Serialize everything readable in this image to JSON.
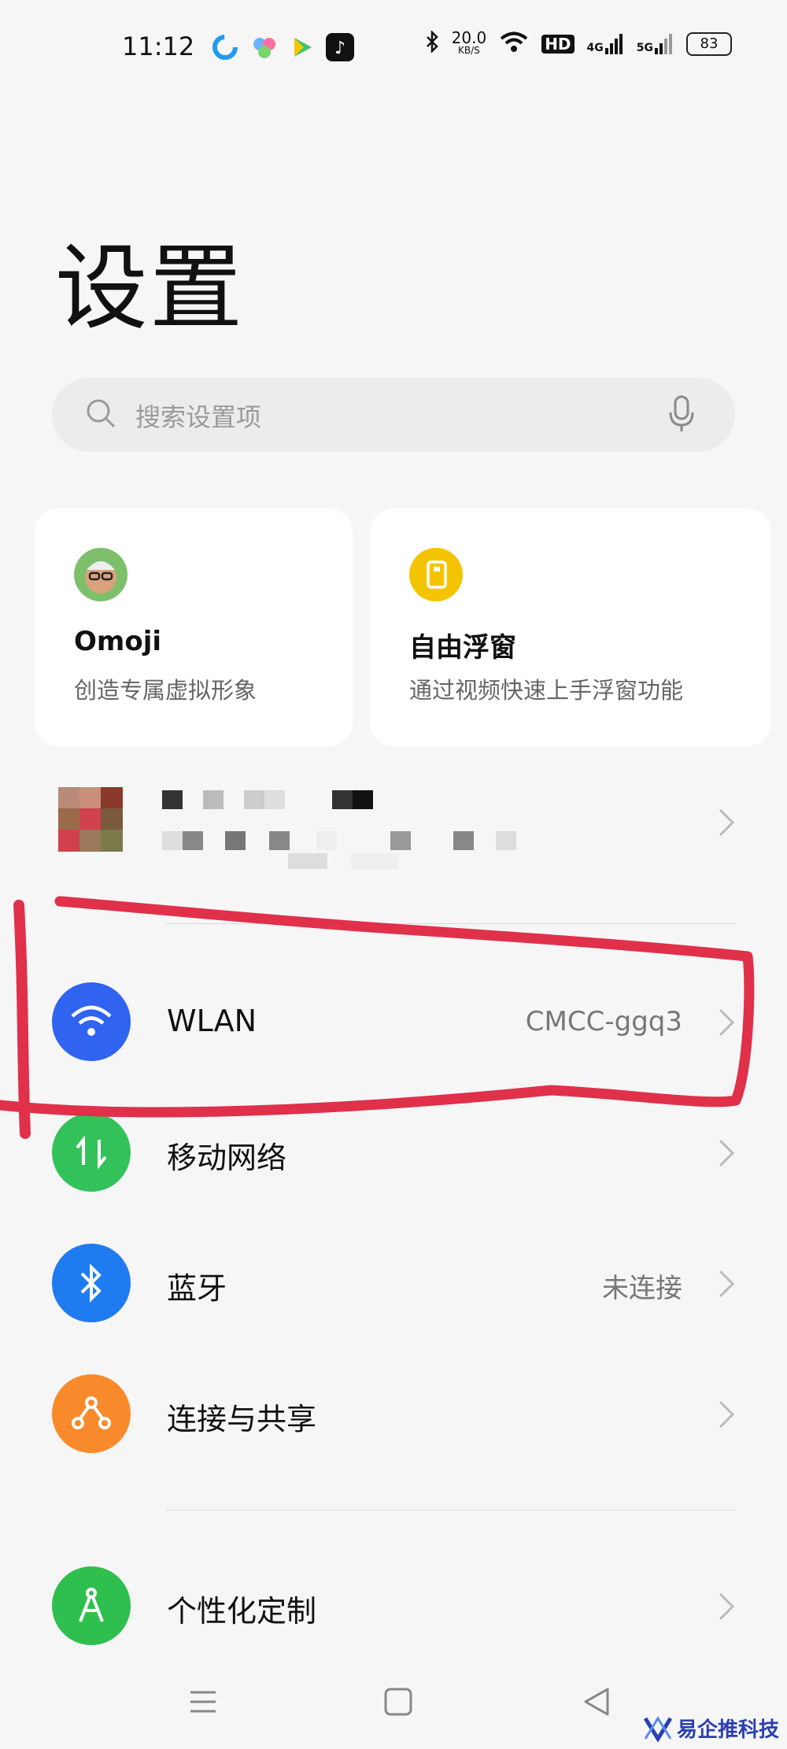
{
  "status_bar": {
    "time": "11:12",
    "speed_value": "20.0",
    "speed_unit": "KB/S",
    "hd": "HD",
    "net1": "4G",
    "net2": "5G",
    "battery": "83"
  },
  "page": {
    "title": "设置"
  },
  "search": {
    "placeholder": "搜索设置项"
  },
  "cards": [
    {
      "title": "Omoji",
      "subtitle": "创造专属虚拟形象",
      "icon": "omoji-avatar-icon"
    },
    {
      "title": "自由浮窗",
      "subtitle": "通过视频快速上手浮窗功能",
      "icon": "floating-window-icon",
      "color": "#f5c400"
    }
  ],
  "rows": [
    {
      "title": "WLAN",
      "value": "CMCC-ggq3",
      "icon": "wifi-icon",
      "color": "#2f63f0"
    },
    {
      "title": "移动网络",
      "value": "",
      "icon": "mobile-data-icon",
      "color": "#33c25a"
    },
    {
      "title": "蓝牙",
      "value": "未连接",
      "icon": "bluetooth-icon",
      "color": "#1f7bf0"
    },
    {
      "title": "连接与共享",
      "value": "",
      "icon": "connection-share-icon",
      "color": "#f98a2c"
    },
    {
      "title": "个性化定制",
      "value": "",
      "icon": "personalize-icon",
      "color": "#2fbf4e"
    }
  ],
  "watermark": {
    "text": "易企推科技"
  },
  "colors": {
    "annotation": "#e0304a",
    "background": "#f6f6f6"
  }
}
